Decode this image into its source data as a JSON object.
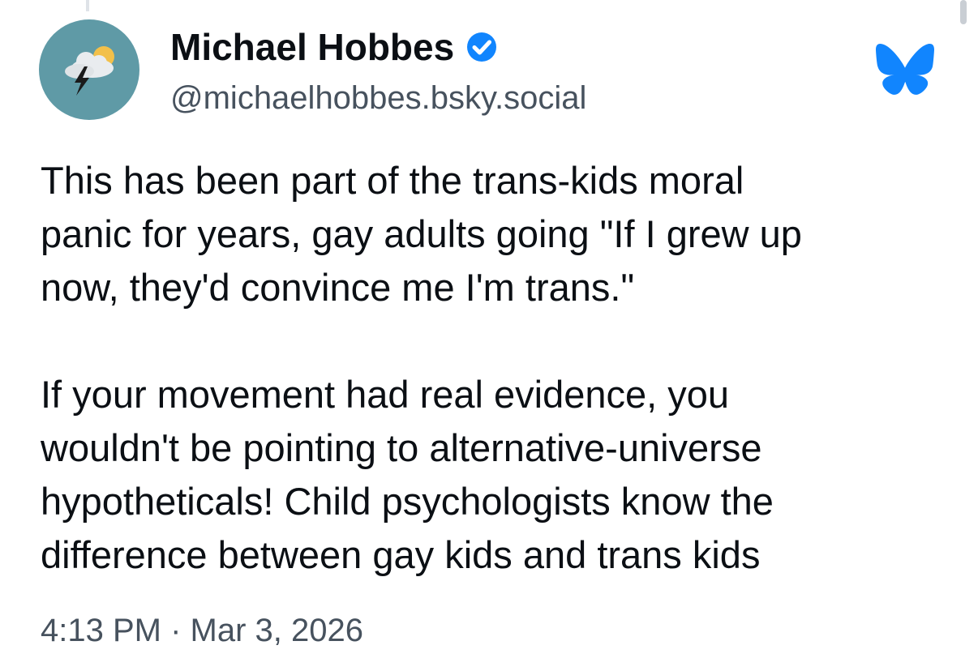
{
  "post": {
    "author": {
      "display_name": "Michael Hobbes",
      "handle": "@michaelhobbes.bsky.social",
      "verified": true,
      "avatar_icon": "storm-cloud-avatar-icon",
      "avatar_color": "#5f9aa6"
    },
    "platform_icon": "bluesky-butterfly-icon",
    "accent_color": "#1185fe",
    "text_lines": [
      "This has been part of the trans-kids moral",
      "panic for years, gay adults going \"If I grew up",
      "now, they'd convince me I'm trans.\"",
      "If your movement had real evidence, you",
      "wouldn't be pointing to alternative-universe",
      "hypotheticals! Child psychologists know the",
      "difference between gay kids and trans kids"
    ],
    "timestamp": "4:13 PM · Mar 3, 2026"
  }
}
